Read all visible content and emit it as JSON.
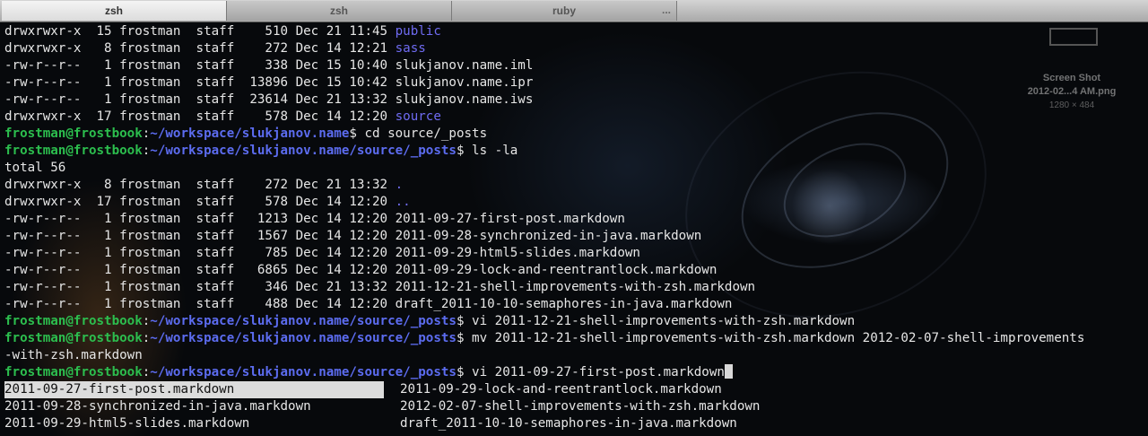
{
  "tabs": [
    {
      "label": "zsh",
      "active": true
    },
    {
      "label": "zsh",
      "active": false
    },
    {
      "label": "ruby",
      "active": false,
      "extra": "..."
    }
  ],
  "desktop": {
    "icon_name": "screenshot-file-icon",
    "file_label": "Screen Shot",
    "file_name": "2012-02...4 AM.png",
    "file_dims": "1280 × 484"
  },
  "prompt": {
    "user": "frostman@frostbook",
    "sep": ":",
    "suffix": "$"
  },
  "colors": {
    "prompt_user": "#2cbe4e",
    "prompt_path": "#5c6cf0",
    "directory": "#6f6bf2",
    "text": "#e6e6e6",
    "background": "#07090c"
  },
  "listing_top": [
    {
      "perm": "drwxrwxr-x",
      "links": "15",
      "owner": "frostman",
      "group": "staff",
      "size": "510",
      "date": "Dec 21 11:45",
      "name": "public",
      "dir": true
    },
    {
      "perm": "drwxrwxr-x",
      "links": "8",
      "owner": "frostman",
      "group": "staff",
      "size": "272",
      "date": "Dec 14 12:21",
      "name": "sass",
      "dir": true
    },
    {
      "perm": "-rw-r--r--",
      "links": "1",
      "owner": "frostman",
      "group": "staff",
      "size": "338",
      "date": "Dec 15 10:40",
      "name": "slukjanov.name.iml",
      "dir": false
    },
    {
      "perm": "-rw-r--r--",
      "links": "1",
      "owner": "frostman",
      "group": "staff",
      "size": "13896",
      "date": "Dec 15 10:42",
      "name": "slukjanov.name.ipr",
      "dir": false
    },
    {
      "perm": "-rw-r--r--",
      "links": "1",
      "owner": "frostman",
      "group": "staff",
      "size": "23614",
      "date": "Dec 21 13:32",
      "name": "slukjanov.name.iws",
      "dir": false
    },
    {
      "perm": "drwxrwxr-x",
      "links": "17",
      "owner": "frostman",
      "group": "staff",
      "size": "578",
      "date": "Dec 14 12:20",
      "name": "source",
      "dir": true
    }
  ],
  "cmd1": {
    "path": "~/workspace/slukjanov.name",
    "command": " cd source/_posts"
  },
  "cmd2": {
    "path": "~/workspace/slukjanov.name/source/_posts",
    "command": " ls -la"
  },
  "total": "total 56",
  "listing_posts": [
    {
      "perm": "drwxrwxr-x",
      "links": "8",
      "owner": "frostman",
      "group": "staff",
      "size": "272",
      "date": "Dec 21 13:32",
      "name": ".",
      "dir": true
    },
    {
      "perm": "drwxrwxr-x",
      "links": "17",
      "owner": "frostman",
      "group": "staff",
      "size": "578",
      "date": "Dec 14 12:20",
      "name": "..",
      "dir": true
    },
    {
      "perm": "-rw-r--r--",
      "links": "1",
      "owner": "frostman",
      "group": "staff",
      "size": "1213",
      "date": "Dec 14 12:20",
      "name": "2011-09-27-first-post.markdown",
      "dir": false
    },
    {
      "perm": "-rw-r--r--",
      "links": "1",
      "owner": "frostman",
      "group": "staff",
      "size": "1567",
      "date": "Dec 14 12:20",
      "name": "2011-09-28-synchronized-in-java.markdown",
      "dir": false
    },
    {
      "perm": "-rw-r--r--",
      "links": "1",
      "owner": "frostman",
      "group": "staff",
      "size": "785",
      "date": "Dec 14 12:20",
      "name": "2011-09-29-html5-slides.markdown",
      "dir": false
    },
    {
      "perm": "-rw-r--r--",
      "links": "1",
      "owner": "frostman",
      "group": "staff",
      "size": "6865",
      "date": "Dec 14 12:20",
      "name": "2011-09-29-lock-and-reentrantlock.markdown",
      "dir": false
    },
    {
      "perm": "-rw-r--r--",
      "links": "1",
      "owner": "frostman",
      "group": "staff",
      "size": "346",
      "date": "Dec 21 13:32",
      "name": "2011-12-21-shell-improvements-with-zsh.markdown",
      "dir": false
    },
    {
      "perm": "-rw-r--r--",
      "links": "1",
      "owner": "frostman",
      "group": "staff",
      "size": "488",
      "date": "Dec 14 12:20",
      "name": "draft_2011-10-10-semaphores-in-java.markdown",
      "dir": false
    }
  ],
  "cmd3": {
    "path": "~/workspace/slukjanov.name/source/_posts",
    "command": " vi 2011-12-21-shell-improvements-with-zsh.markdown"
  },
  "cmd4": {
    "path": "~/workspace/slukjanov.name/source/_posts",
    "command": " mv 2011-12-21-shell-improvements-with-zsh.markdown 2012-02-07-shell-improvements",
    "wrap": "-with-zsh.markdown"
  },
  "cmd5": {
    "path": "~/workspace/slukjanov.name/source/_posts",
    "command": " vi 2011-09-27-first-post.markdown"
  },
  "completion": {
    "left": [
      "2011-09-27-first-post.markdown",
      "2011-09-28-synchronized-in-java.markdown",
      "2011-09-29-html5-slides.markdown"
    ],
    "right": [
      "2011-09-29-lock-and-reentrantlock.markdown",
      "2012-02-07-shell-improvements-with-zsh.markdown",
      "draft_2011-10-10-semaphores-in-java.markdown"
    ],
    "selected": "2011-09-27-first-post.markdown"
  }
}
